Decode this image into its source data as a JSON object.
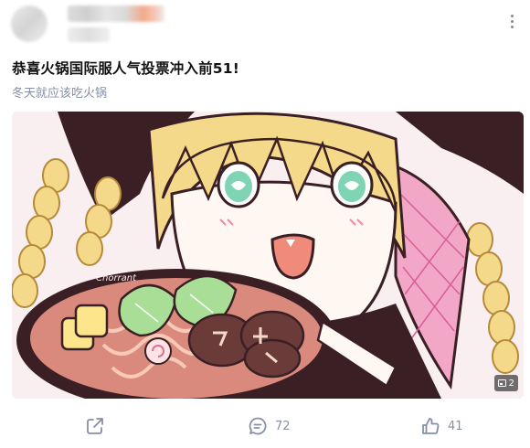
{
  "post": {
    "title": "恭喜火锅国际服人气投票冲入前51!",
    "subtitle": "冬天就应该吃火锅",
    "image": {
      "alt": "",
      "drawn_text": "Chorrant",
      "image_count": "2"
    }
  },
  "actions": {
    "share_icon": "share-icon",
    "comment_count": "72",
    "like_count": "41"
  },
  "icons": [
    "more-vertical-icon",
    "share-icon",
    "comment-icon",
    "thumbs-up-icon",
    "image-icon"
  ],
  "colors": {
    "text_primary": "#121212",
    "text_secondary": "#8590a6",
    "badge_bg": "#000000"
  }
}
